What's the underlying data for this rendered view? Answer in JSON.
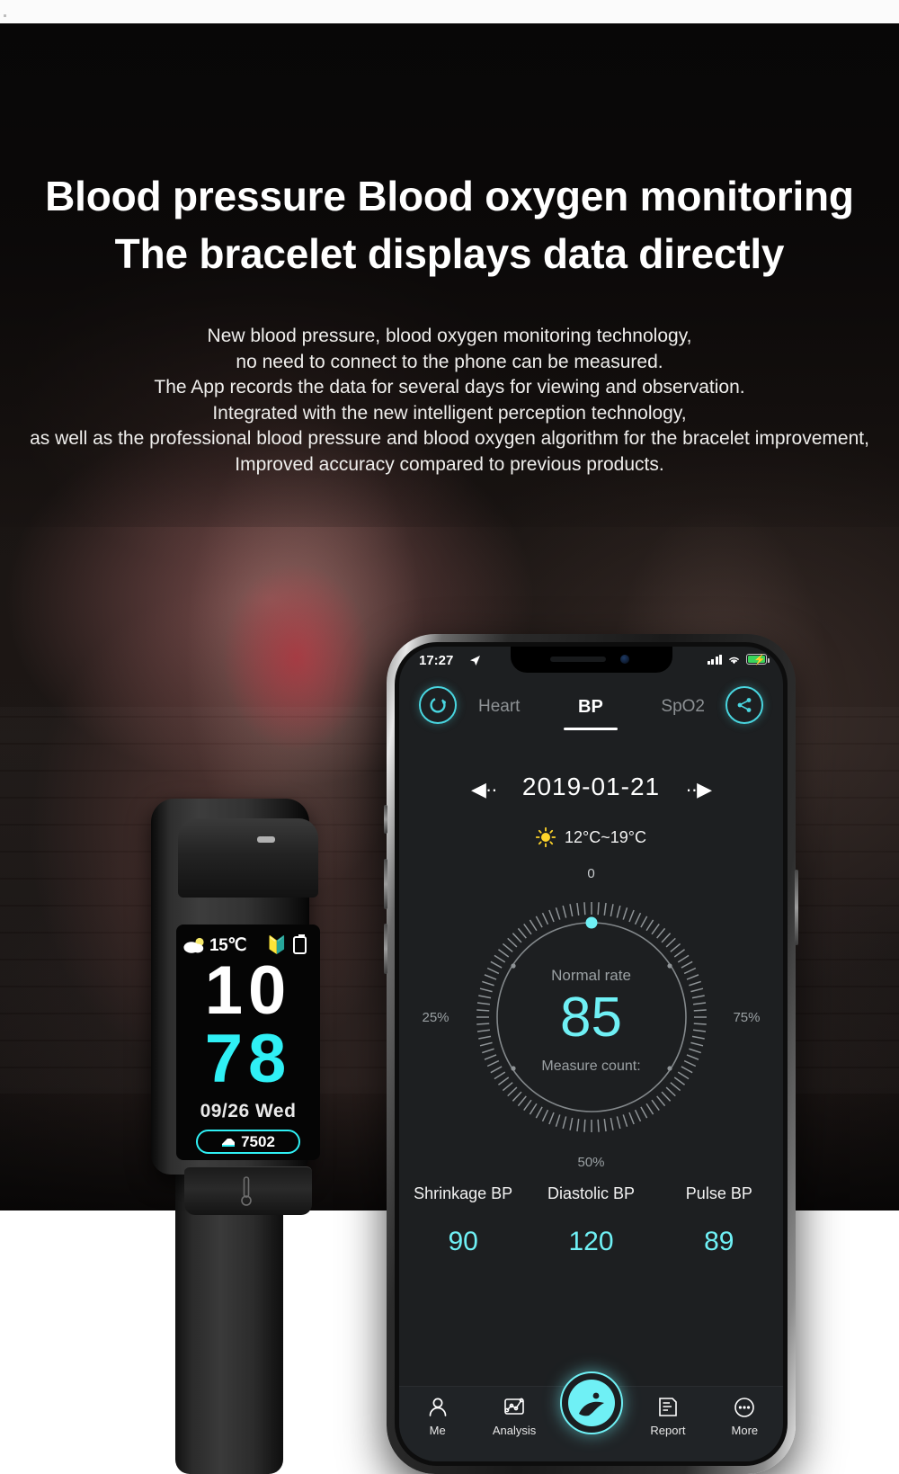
{
  "headline": {
    "line1": "Blood pressure  Blood oxygen monitoring",
    "line2": "The bracelet displays data directly"
  },
  "body_copy": [
    "New blood pressure, blood oxygen monitoring technology,",
    "no need to connect to the phone can be measured.",
    "The App records the data for several days for viewing and observation.",
    "Integrated with the new intelligent perception technology,",
    "as well as the professional blood pressure and blood oxygen algorithm for the bracelet improvement,",
    "Improved accuracy compared to previous products."
  ],
  "bracelet": {
    "weather_icon": "cloud-sun-icon",
    "temperature": "15℃",
    "bluetooth_icon": "bluetooth-icon",
    "battery_icon": "battery-icon",
    "hour": "10",
    "minute": "78",
    "date": "09/26  Wed",
    "steps_icon": "shoe-icon",
    "steps": "7502",
    "thermometer_icon": "thermometer-icon"
  },
  "phone": {
    "statusbar": {
      "time": "17:27",
      "location_icon": "location-arrow-icon",
      "signal_icon": "signal-bars-icon",
      "wifi_icon": "wifi-icon",
      "battery_icon": "battery-charging-icon"
    },
    "topbar": {
      "refresh_icon": "refresh-circle-icon",
      "share_icon": "share-circle-icon",
      "tabs": [
        {
          "label": "Heart",
          "active": false
        },
        {
          "label": "BP",
          "active": true
        },
        {
          "label": "SpO2",
          "active": false
        }
      ]
    },
    "date_nav": {
      "prev_icon": "prev-day-icon",
      "prev_glyph": "◀··",
      "date": "2019-01-21",
      "next_icon": "next-day-icon",
      "next_glyph": "··▶"
    },
    "weather": {
      "icon": "sun-icon",
      "text": "12°C~19°C"
    },
    "gauge": {
      "status_label": "Normal rate",
      "value": "85",
      "count_label": "Measure count:",
      "tick_top": "0",
      "tick_left": "25%",
      "tick_right": "75%",
      "tick_bottom": "50%",
      "accent_color": "#6ff0f5"
    },
    "metrics": [
      {
        "label": "Shrinkage BP",
        "value": "90"
      },
      {
        "label": "Diastolic BP",
        "value": "120"
      },
      {
        "label": "Pulse BP",
        "value": "89"
      }
    ],
    "tabbar": [
      {
        "label": "Me",
        "icon": "person-icon"
      },
      {
        "label": "Analysis",
        "icon": "chart-icon"
      },
      {
        "label": "Report",
        "icon": "document-icon"
      },
      {
        "label": "More",
        "icon": "ellipsis-circle-icon"
      }
    ],
    "center_button_icon": "app-logo-icon"
  }
}
